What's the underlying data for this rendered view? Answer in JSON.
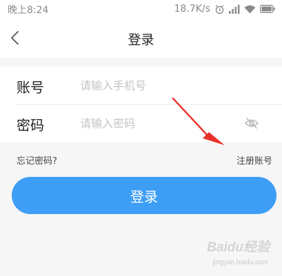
{
  "status_bar": {
    "time": "晚上8:24",
    "network_speed": "18.7K/s",
    "icons": [
      "alarm-icon",
      "signal-icon",
      "wifi-icon",
      "battery-icon"
    ]
  },
  "nav": {
    "back_icon": "chevron-left-icon",
    "title": "登录"
  },
  "form": {
    "account": {
      "label": "账号",
      "placeholder": "请输入手机号",
      "value": ""
    },
    "password": {
      "label": "密码",
      "placeholder": "请输入密码",
      "value": "",
      "toggle_icon": "eye-off-icon"
    }
  },
  "links": {
    "forgot_password": "忘记密码?",
    "register": "注册账号"
  },
  "login_button": {
    "label": "登录",
    "color": "#3e9ef5"
  },
  "annotation": {
    "arrow_color": "#e8302a"
  },
  "watermark": {
    "brand": "Baidu经验",
    "url": "jingyan.baidu.com"
  }
}
